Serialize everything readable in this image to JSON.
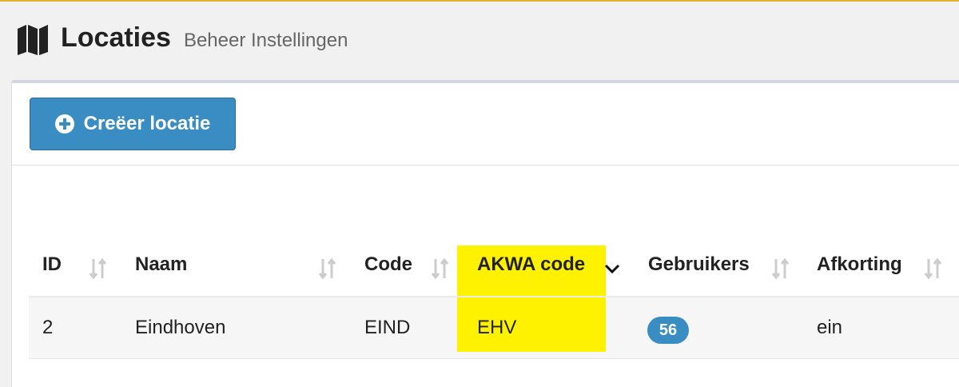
{
  "header": {
    "title": "Locaties",
    "subtitle": "Beheer Instellingen",
    "icon": "map-icon"
  },
  "toolbar": {
    "create_label": "Creëer locatie",
    "create_icon": "plus-circle-icon",
    "button_color": "#3a8dc2"
  },
  "table": {
    "columns": [
      {
        "label": "ID",
        "sort": "unsorted"
      },
      {
        "label": "Naam",
        "sort": "unsorted"
      },
      {
        "label": "Code",
        "sort": "unsorted"
      },
      {
        "label": "AKWA code",
        "sort": "descending"
      },
      {
        "label": "Gebruikers",
        "sort": "unsorted"
      },
      {
        "label": "Afkorting",
        "sort": "unsorted"
      }
    ],
    "rows": [
      {
        "id": "2",
        "naam": "Eindhoven",
        "code": "EIND",
        "akwa_code": "EHV",
        "gebruikers": "56",
        "afkorting": "ein"
      }
    ],
    "highlight_color": "#fff200"
  }
}
